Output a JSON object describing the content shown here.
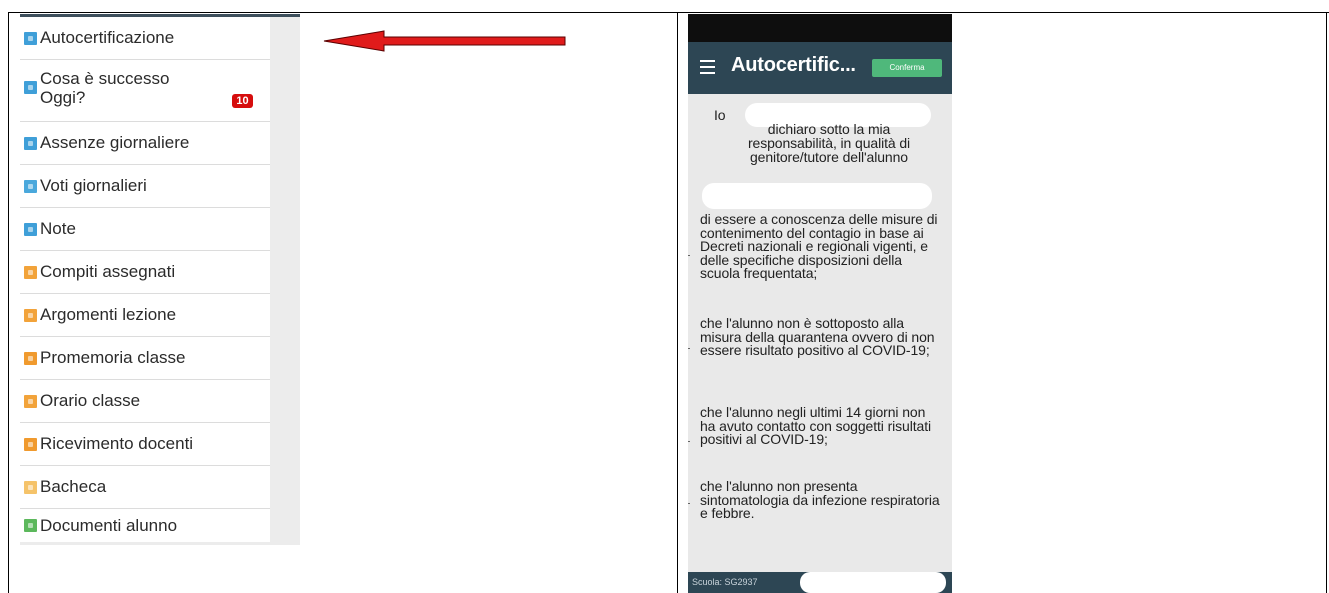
{
  "menu": {
    "items": [
      {
        "label": "Autocertificazione",
        "color": "#3f9fd8",
        "icon": "info-square-icon"
      },
      {
        "label": "Cosa è successo Oggi?",
        "color": "#3f9fd8",
        "icon": "info-square-icon",
        "badge": "10"
      },
      {
        "label": "Assenze giornaliere",
        "color": "#3f9fd8",
        "icon": "calendar-square-icon"
      },
      {
        "label": "Voti giornalieri",
        "color": "#4aa8dc",
        "icon": "grades-square-icon"
      },
      {
        "label": "Note",
        "color": "#3f9fd8",
        "icon": "notes-square-icon"
      },
      {
        "label": "Compiti assegnati",
        "color": "#f2a33a",
        "icon": "homework-square-icon"
      },
      {
        "label": "Argomenti lezione",
        "color": "#f2a33a",
        "icon": "topics-square-icon"
      },
      {
        "label": "Promemoria classe",
        "color": "#f09a2e",
        "icon": "reminder-square-icon"
      },
      {
        "label": "Orario classe",
        "color": "#f2a33a",
        "icon": "timetable-square-icon"
      },
      {
        "label": "Ricevimento docenti",
        "color": "#f09a2e",
        "icon": "meeting-square-icon"
      },
      {
        "label": "Bacheca",
        "color": "#f5c36a",
        "icon": "board-square-icon"
      },
      {
        "label": "Documenti alunno",
        "color": "#5cb85c",
        "icon": "documents-square-icon"
      }
    ]
  },
  "arrow": {
    "color": "#e01b1b"
  },
  "phone": {
    "title": "Autocertific...",
    "confirm_label": "Conferma",
    "intro_io": "Io",
    "declaration": "dichiaro sotto la mia responsabilità, in qualità di genitore/tutore dell'alunno",
    "paragraphs": [
      "di essere a conoscenza delle misure di contenimento del contagio in base ai Decreti nazionali e regionali vigenti, e delle specifiche disposizioni della scuola frequentata;",
      "che l'alunno non è sottoposto alla misura della quarantena ovvero di non essere risultato positivo al COVID-19;",
      "che l'alunno negli ultimi 14 giorni non ha avuto contatto con soggetti risultati positivi al COVID-19;",
      "che l'alunno non presenta sintomatologia da infezione respiratoria e febbre."
    ],
    "footer_school": "Scuola: SG2937",
    "header_color": "#2d4654",
    "confirm_color": "#4fb87b"
  }
}
